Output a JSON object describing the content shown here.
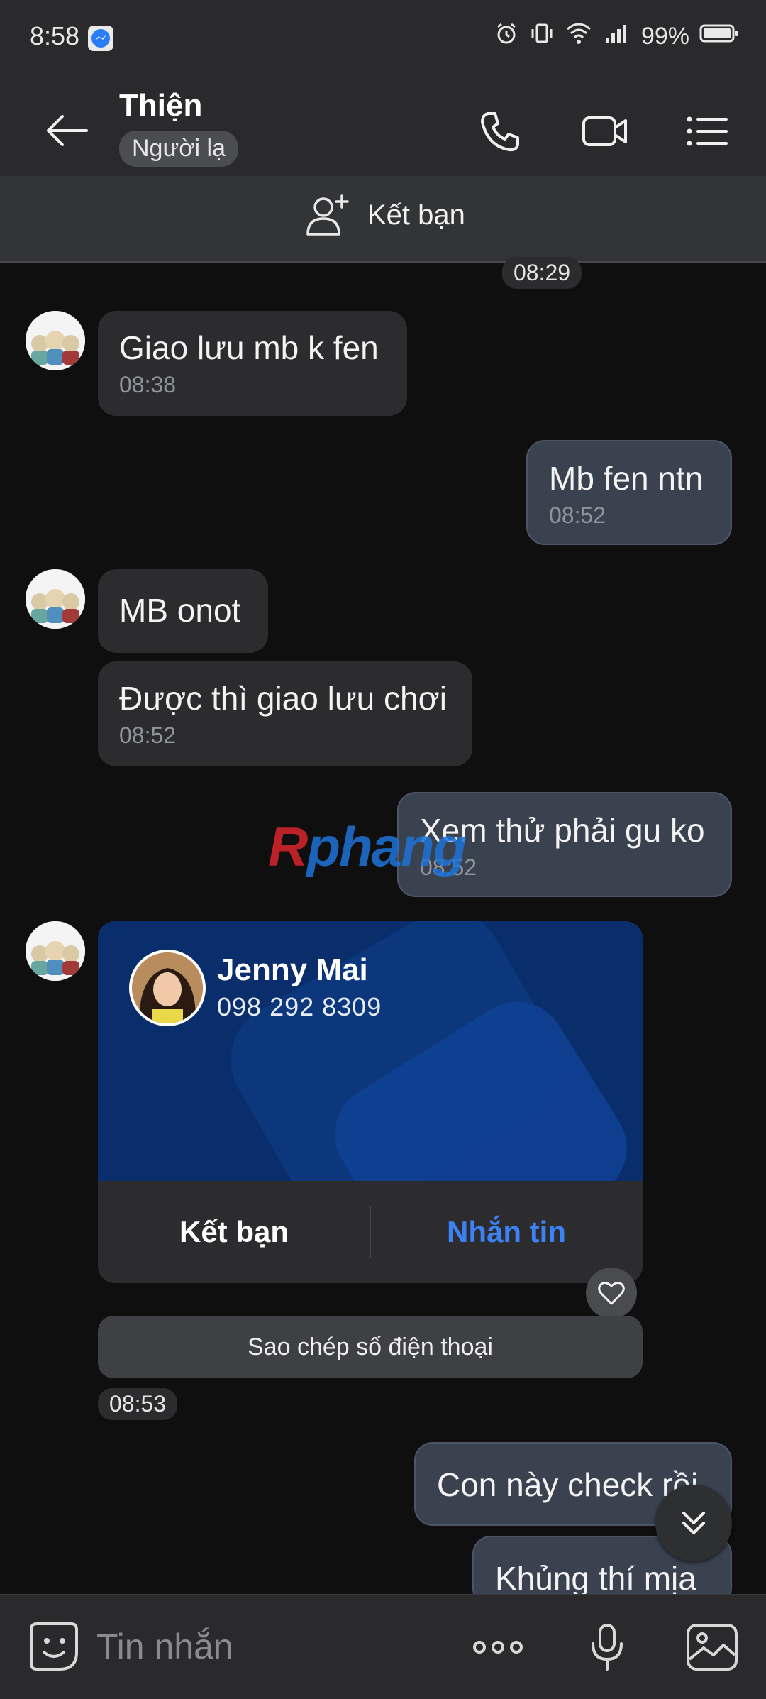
{
  "status": {
    "time": "8:58",
    "battery": "99%"
  },
  "header": {
    "name": "Thiện",
    "badge": "Người lạ"
  },
  "add_friend": {
    "label": "Kết bạn"
  },
  "time_chip_top": "08:29",
  "messages": [
    {
      "side": "in",
      "text": "Giao lưu mb k fen",
      "time": "08:38"
    },
    {
      "side": "out",
      "text": "Mb fen ntn",
      "time": "08:52"
    },
    {
      "side": "in",
      "text": "MB onot",
      "time": ""
    },
    {
      "side": "in",
      "text": "Được thì giao lưu chơi",
      "time": "08:52"
    },
    {
      "side": "out",
      "text": "Xem thử phải gu ko",
      "time": "08:52"
    }
  ],
  "contact_card": {
    "name": "Jenny Mai",
    "phone": "098 292 8309",
    "add_friend_label": "Kết bạn",
    "message_label": "Nhắn tin",
    "copy_label": "Sao chép số điện thoại",
    "time": "08:53"
  },
  "messages_bottom": [
    {
      "side": "out",
      "text": "Con này check rồi"
    },
    {
      "side": "out",
      "text": "Khủng thí mịa"
    }
  ],
  "watermark": {
    "r": "R",
    "rest": "phang"
  },
  "input": {
    "placeholder": "Tin nhắn"
  },
  "colors": {
    "accent_blue": "#3d82f5",
    "card_blue": "#0a2e6b",
    "out_bubble": "#3a4250",
    "in_bubble": "#2c2c2e"
  }
}
